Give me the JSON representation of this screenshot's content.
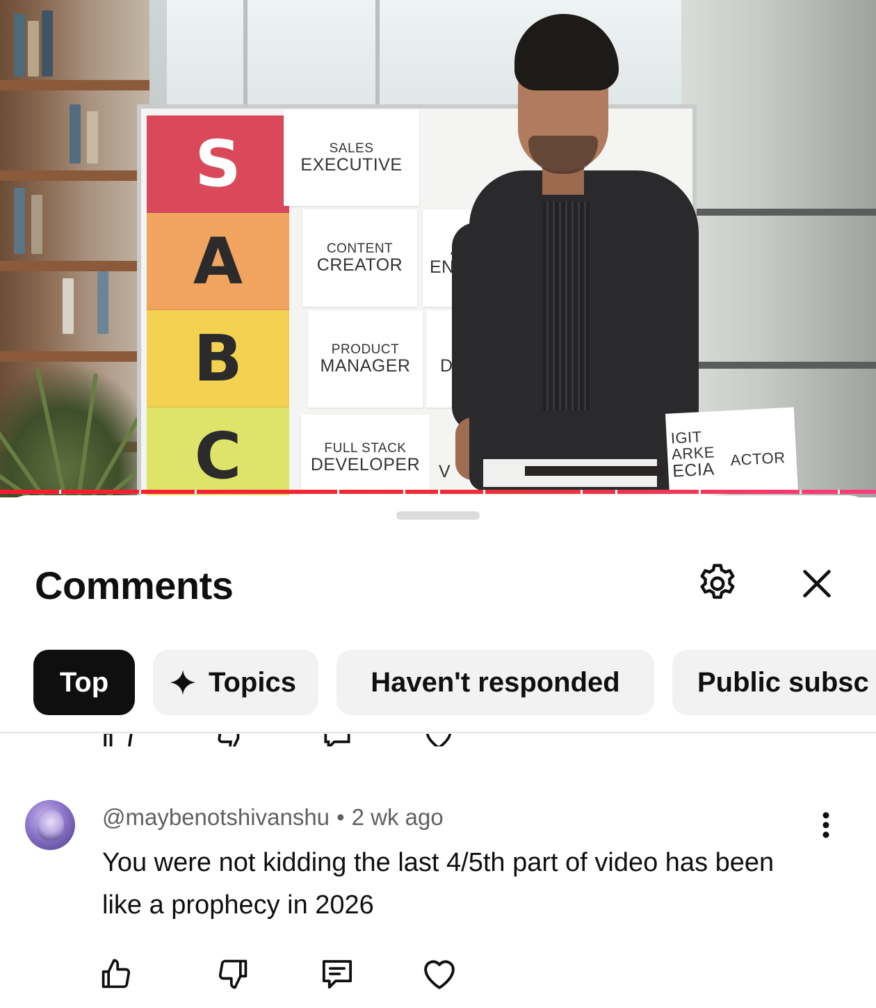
{
  "video": {
    "tiers": [
      "S",
      "A",
      "B",
      "C"
    ],
    "cards": {
      "sales_l1": "SALES",
      "sales_l2": "EXECUTIVE",
      "content_l1": "CONTENT",
      "content_l2": "CREATOR",
      "ai_l1": "AI/",
      "ai_l2": "ENGI",
      "product_l1": "PRODUCT",
      "product_l2": "MANAGER",
      "ux_l1": "U",
      "ux_l2": "DE",
      "fullstack_l1": "FULL STACK",
      "fullstack_l2": "DEVELOPER",
      "w_frag": "V",
      "digital_l1": "IGIT",
      "digital_l2": "ARKE",
      "digital_l3": "ECIA",
      "actor": "ACTOR"
    }
  },
  "sheet": {
    "title": "Comments",
    "settings_icon": "gear-icon",
    "close_icon": "close-icon"
  },
  "chips": [
    {
      "label": "Top",
      "active": true
    },
    {
      "label": "Topics",
      "icon": "sparkle-icon",
      "active": false
    },
    {
      "label": "Haven't responded",
      "active": false
    },
    {
      "label": "Public subsc",
      "active": false
    }
  ],
  "comment": {
    "author": "@maybenotshivanshu",
    "separator": "•",
    "time": "2 wk ago",
    "text": "You were not kidding the last 4/5th part of video has been like a prophecy in 2026",
    "actions": [
      "thumbs-up-icon",
      "thumbs-down-icon",
      "reply-icon",
      "heart-icon"
    ]
  },
  "colors": {
    "accent_red": "#ff0033",
    "chip_active_bg": "#0f0f0f",
    "chip_bg": "#f2f2f2",
    "meta_text": "#606060"
  }
}
